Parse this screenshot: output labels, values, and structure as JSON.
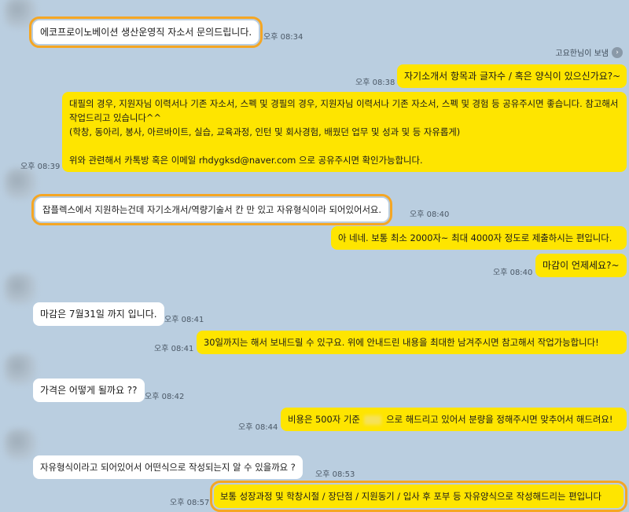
{
  "messages": [
    {
      "text": "에코프로이노베이션 생산운영직 자소서 문의드립니다.",
      "time": "오후 08:34"
    },
    {
      "text": "자기소개서 항목과 글자수 / 혹은 양식이 있으신가요?~",
      "time": "오후 08:38"
    },
    {
      "line1": "대필의 경우, 지원자님 이력서나 기존 자소서, 스펙 및 경필의 경우, 지원자님 이력서나 기존 자소서, 스펙 및 경험 등 공유주시면 좋습니다. 참고해서 작업드리고 있습니다^^",
      "line2": "(학창, 동아리, 봉사, 아르바이트, 실습, 교육과정, 인턴 및 회사경험, 배웠던 업무 및 성과 및 등 자유롭게)",
      "line3": "위와 관련해서 카톡방 혹은 이메일 rhdygksd@naver.com 으로 공유주시면 확인가능합니다.",
      "time": "오후 08:39"
    },
    {
      "text": "잡플렉스에서 지원하는건데 자기소개서/역량기술서 칸 만 있고 자유형식이라 되어있어서요.",
      "time": "오후 08:40"
    },
    {
      "text": "아 네네. 보통 최소 2000자~ 최대 4000자 정도로 제출하시는 편입니다.",
      "time": ""
    },
    {
      "text": "마감이 언제세요?~",
      "time": "오후 08:40"
    },
    {
      "text": "마감은 7월31일 까지 입니다.",
      "time": "오후 08:41"
    },
    {
      "text": "30일까지는 해서 보내드릴 수 있구요. 위에 안내드린 내용을 최대한 남겨주시면 참고해서 작업가능합니다!",
      "time": "오후 08:41"
    },
    {
      "text": "가격은 어떻게 될까요 ??",
      "time": "오후 08:42"
    },
    {
      "text_a": "비용은 500자 기준",
      "text_b": "으로 해드리고 있어서 분량을 정해주시면 맞추어서 해드려요!",
      "time": "오후 08:44"
    },
    {
      "text": "자유형식이라고 되어있어서 어떤식으로 작성되는지 알 수 있을까요 ?",
      "time": "오후 08:53"
    },
    {
      "text": "보통 성장과정 및 학창시절 / 장단점 / 지원동기 / 입사 후 포부 등 자유양식으로 작성해드리는 편입니다",
      "time": "오후 08:57"
    }
  ],
  "sender": {
    "name": "고요한님이 보냄",
    "icon": "chevron-right-icon"
  },
  "colors": {
    "background": "#bacee0",
    "outgoing": "#fee500",
    "incoming": "#ffffff",
    "highlight": "#f5a623"
  }
}
